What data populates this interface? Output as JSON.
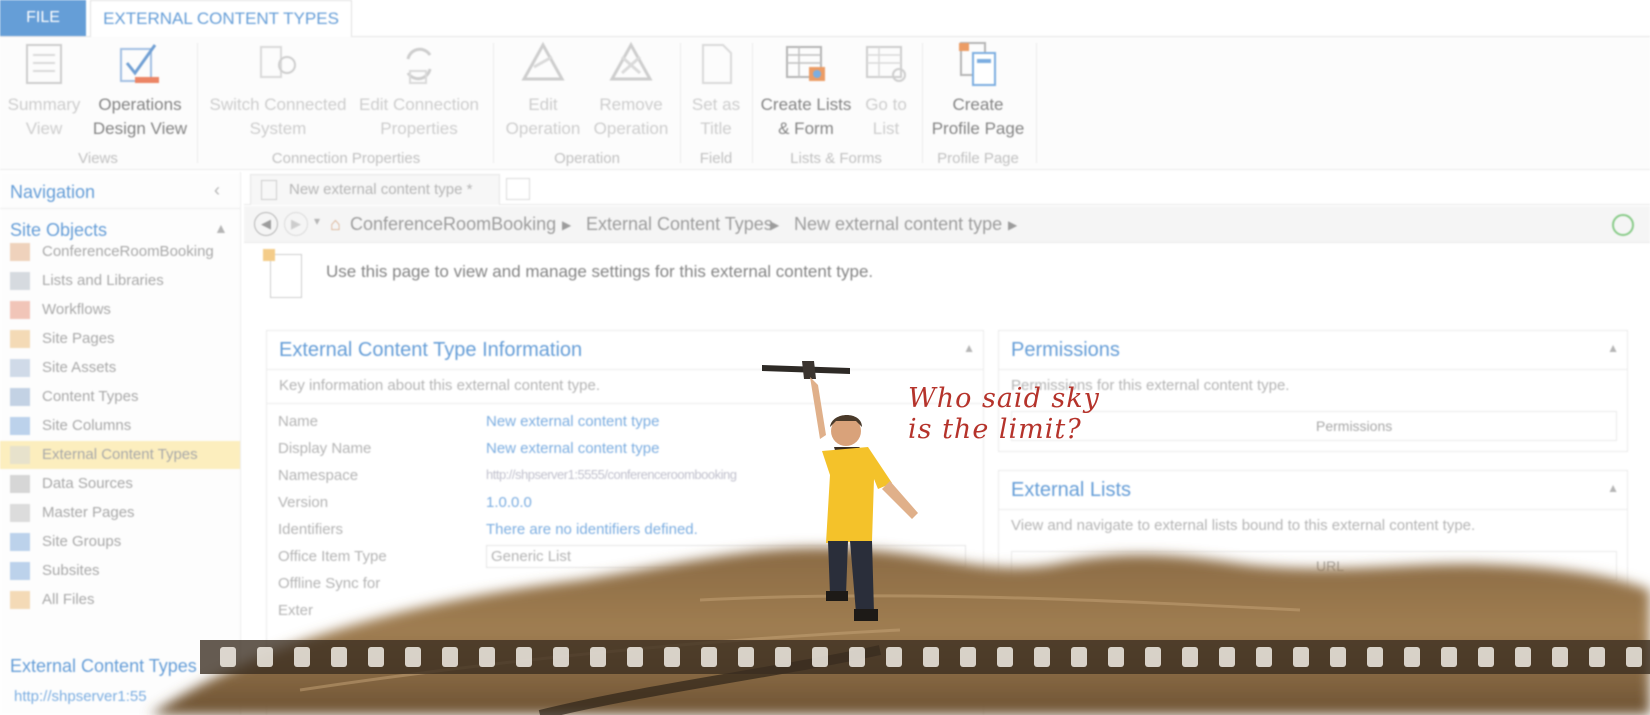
{
  "ribbon": {
    "tabs": {
      "file": "FILE",
      "active": "EXTERNAL CONTENT TYPES"
    },
    "buttons": {
      "summary_view": [
        "Summary",
        "View"
      ],
      "operations_design_view": [
        "Operations",
        "Design View"
      ],
      "switch_connected_system": [
        "Switch Connected",
        "System"
      ],
      "edit_connection_properties": [
        "Edit Connection",
        "Properties"
      ],
      "edit_operation": [
        "Edit",
        "Operation"
      ],
      "remove_operation": [
        "Remove",
        "Operation"
      ],
      "set_as_title": [
        "Set as",
        "Title"
      ],
      "create_lists_form": [
        "Create Lists",
        "& Form"
      ],
      "go_to_list": [
        "Go to",
        "List"
      ],
      "create_profile_page": [
        "Create",
        "Profile Page"
      ]
    },
    "groups": {
      "views": "Views",
      "connection_properties": "Connection Properties",
      "operation": "Operation",
      "field": "Field",
      "lists_forms": "Lists & Forms",
      "profile_page": "Profile Page"
    }
  },
  "navigation": {
    "title": "Navigation",
    "site_objects_header": "Site Objects",
    "items": [
      {
        "label": "ConferenceRoomBooking",
        "icon": "home-icon"
      },
      {
        "label": "Lists and Libraries",
        "icon": "list-icon"
      },
      {
        "label": "Workflows",
        "icon": "workflow-icon"
      },
      {
        "label": "Site Pages",
        "icon": "pages-icon"
      },
      {
        "label": "Site Assets",
        "icon": "assets-icon"
      },
      {
        "label": "Content Types",
        "icon": "content-types-icon"
      },
      {
        "label": "Site Columns",
        "icon": "column-icon"
      },
      {
        "label": "External Content Types",
        "icon": "external-content-icon",
        "selected": true
      },
      {
        "label": "Data Sources",
        "icon": "database-icon"
      },
      {
        "label": "Master Pages",
        "icon": "master-page-icon"
      },
      {
        "label": "Site Groups",
        "icon": "groups-icon"
      },
      {
        "label": "Subsites",
        "icon": "subsites-icon"
      },
      {
        "label": "All Files",
        "icon": "folder-icon"
      }
    ],
    "ect_header": "External Content Types",
    "ect_url": "http://shpserver1:55"
  },
  "document": {
    "tab_label": "New external content type *",
    "breadcrumb": [
      "ConferenceRoomBooking",
      "External Content Types",
      "New external content type"
    ],
    "intro": "Use this page to view and manage settings for this external content type."
  },
  "info_section": {
    "title": "External Content Type Information",
    "description": "Key information about this external content type.",
    "fields": [
      {
        "label": "Name",
        "value": "New external content type"
      },
      {
        "label": "Display Name",
        "value": "New external content type"
      },
      {
        "label": "Namespace",
        "value": "http://shpserver1:5555/conferenceroombooking"
      },
      {
        "label": "Version",
        "value": "1.0.0.0"
      },
      {
        "label": "Identifiers",
        "value": "There are no identifiers defined."
      },
      {
        "label": "Office Item Type",
        "value": "Generic List"
      },
      {
        "label": "Offline Sync for",
        "value": ""
      },
      {
        "label": "Exter",
        "value": ""
      }
    ]
  },
  "permissions_section": {
    "title": "Permissions",
    "description": "Permissions for this external content type.",
    "column": "Permissions"
  },
  "external_lists_section": {
    "title": "External Lists",
    "description": "View and navigate to external lists bound to this external content type.",
    "column": "URL"
  },
  "overlay": {
    "slogan_line1": "Who said sky",
    "slogan_line2": "is the limit?"
  },
  "colors": {
    "accent": "#2b79c9",
    "slogan": "#b5332b",
    "selected": "#fbe8a6"
  }
}
